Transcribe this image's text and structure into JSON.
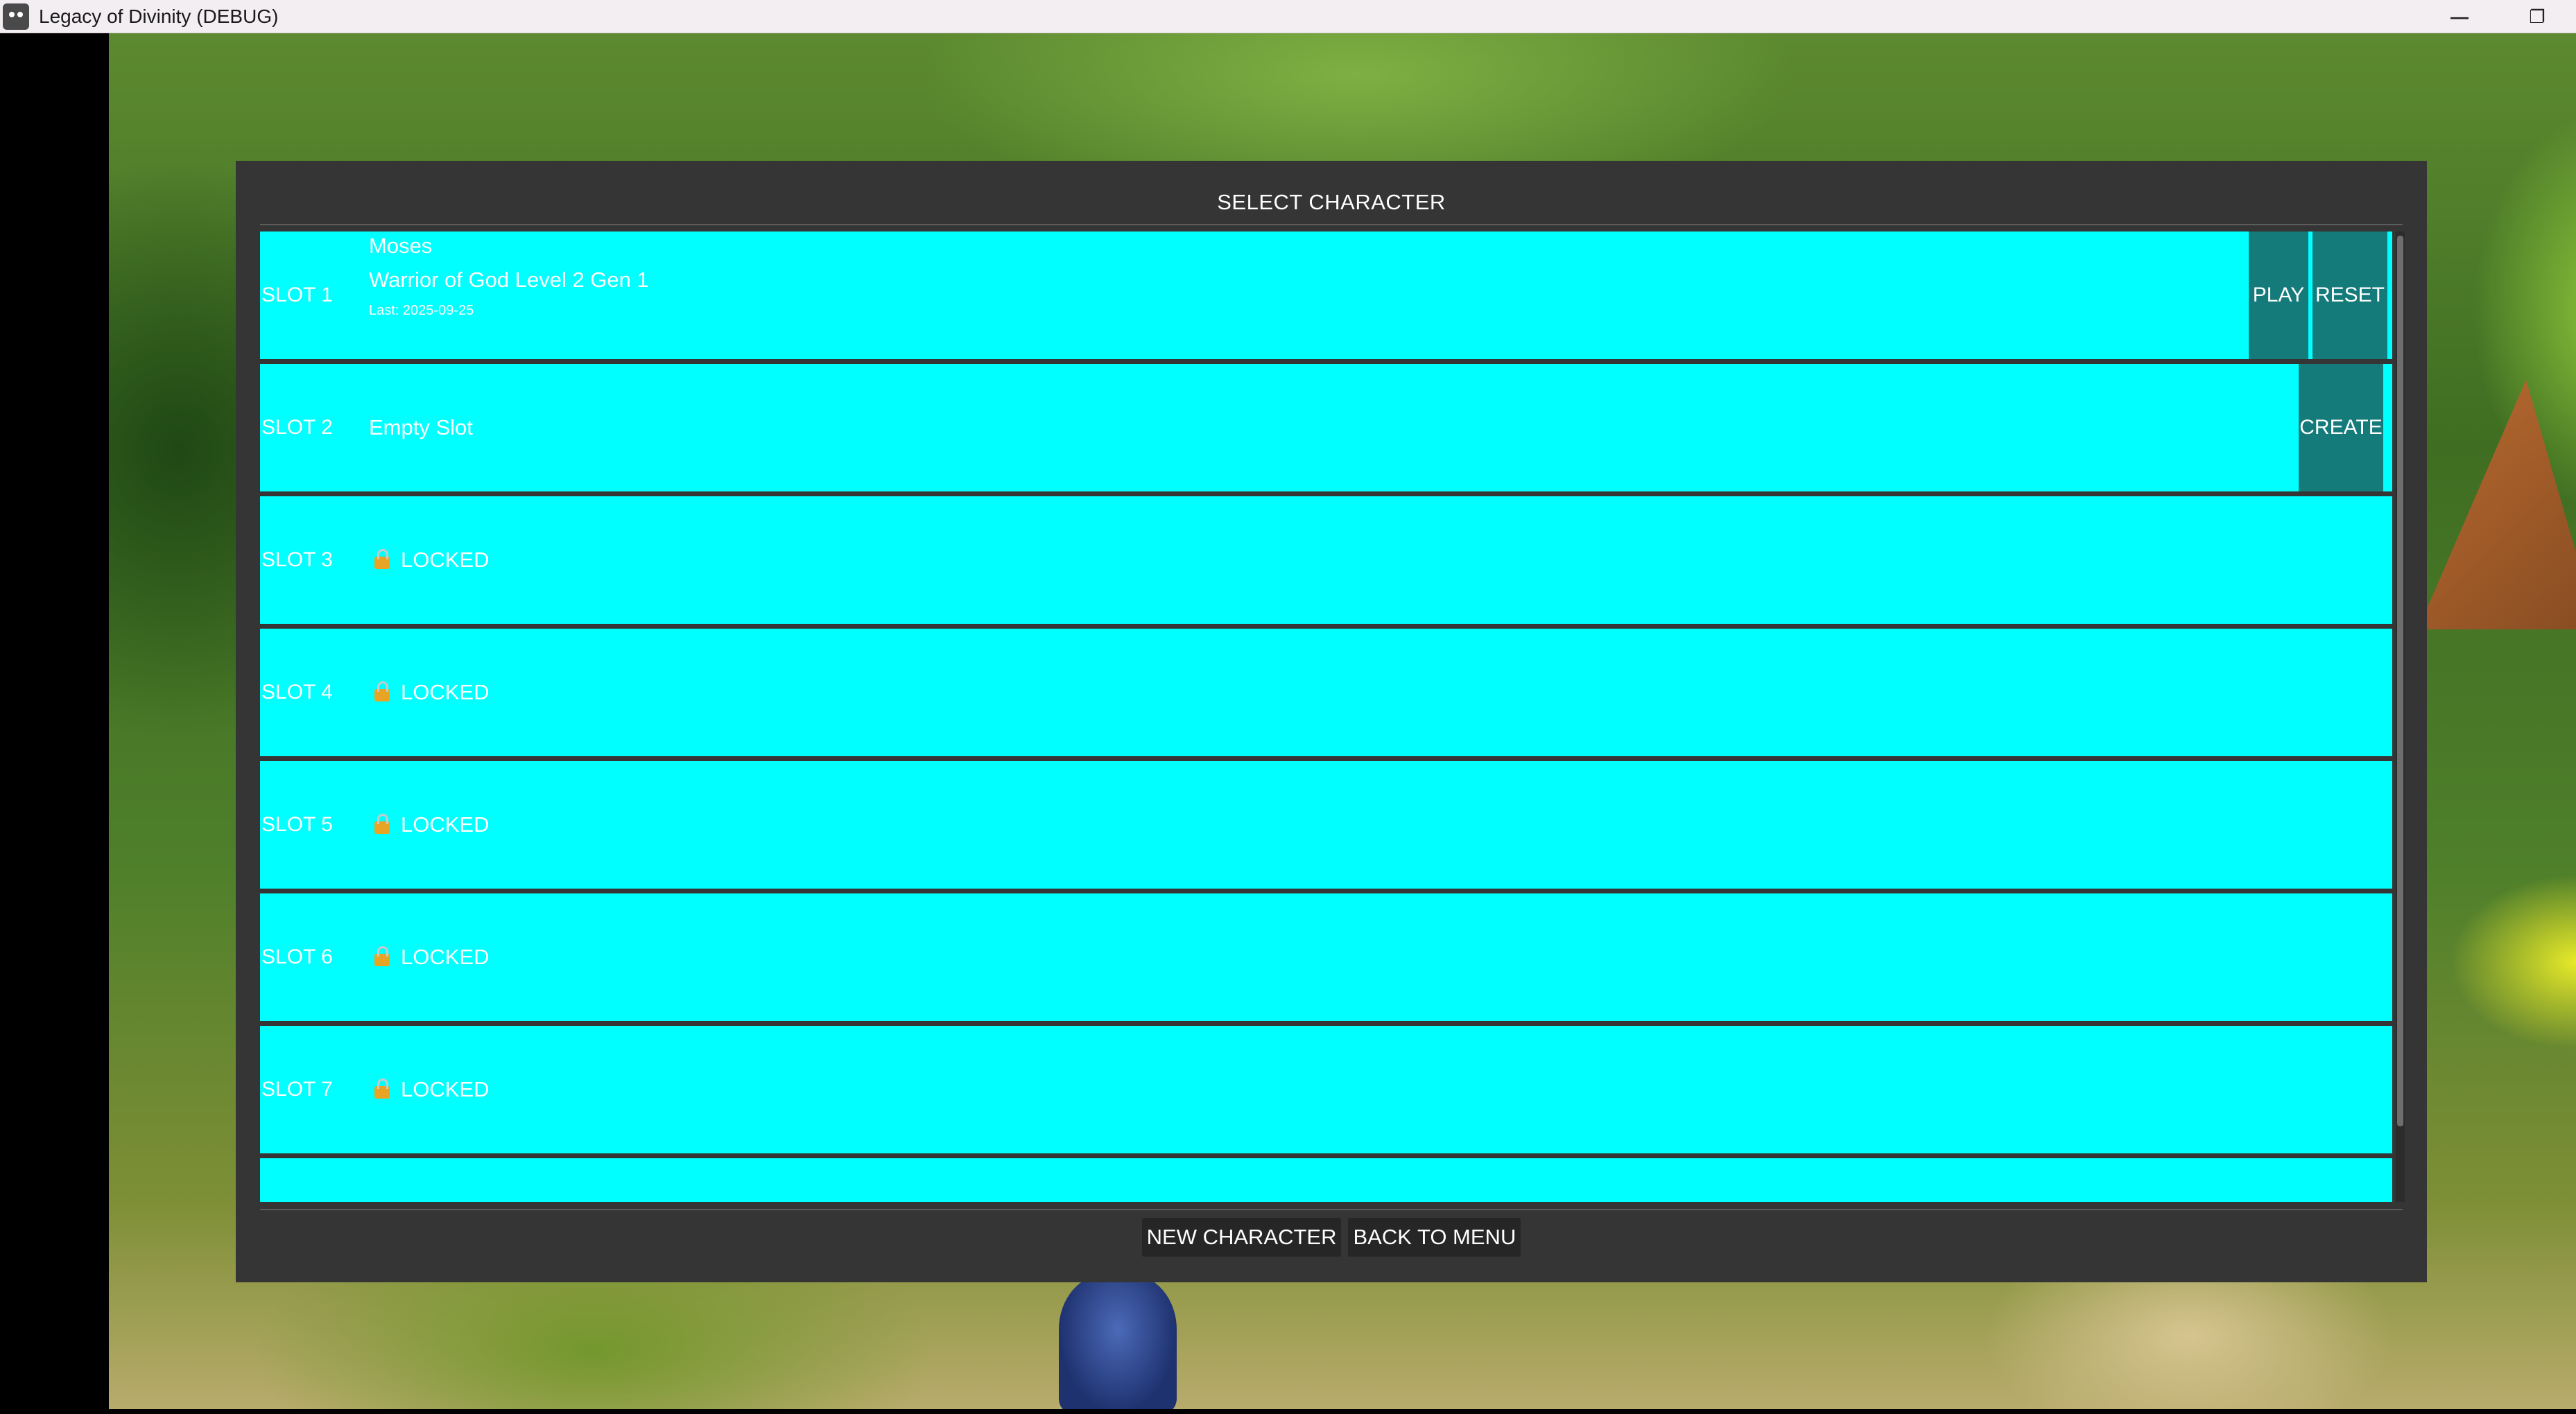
{
  "window": {
    "title": "Legacy of Divinity (DEBUG)",
    "minimize_glyph": "—",
    "restore_glyph": "❐"
  },
  "panel": {
    "title": "SELECT CHARACTER"
  },
  "slots": [
    {
      "label": "SLOT 1",
      "name": "Moses",
      "class_line": "Warrior of God Level 2 Gen 1",
      "last": "Last: 2025-09-25",
      "buttons": [
        "PLAY",
        "RESET"
      ]
    },
    {
      "label": "SLOT 2",
      "status": "Empty Slot",
      "buttons": [
        "CREATE"
      ]
    },
    {
      "label": "SLOT 3",
      "status": "LOCKED",
      "icon": "lock-icon"
    },
    {
      "label": "SLOT 4",
      "status": "LOCKED",
      "icon": "lock-icon"
    },
    {
      "label": "SLOT 5",
      "status": "LOCKED",
      "icon": "lock-icon"
    },
    {
      "label": "SLOT 6",
      "status": "LOCKED",
      "icon": "lock-icon"
    },
    {
      "label": "SLOT 7",
      "status": "LOCKED",
      "icon": "lock-icon"
    }
  ],
  "footer": {
    "new_character": "NEW CHARACTER",
    "back_to_menu": "BACK TO MENU"
  },
  "colors": {
    "slot_background": "#00ffff",
    "slot_button": "#147a7a",
    "panel_background": "#353535",
    "lock": "#e8a424"
  }
}
